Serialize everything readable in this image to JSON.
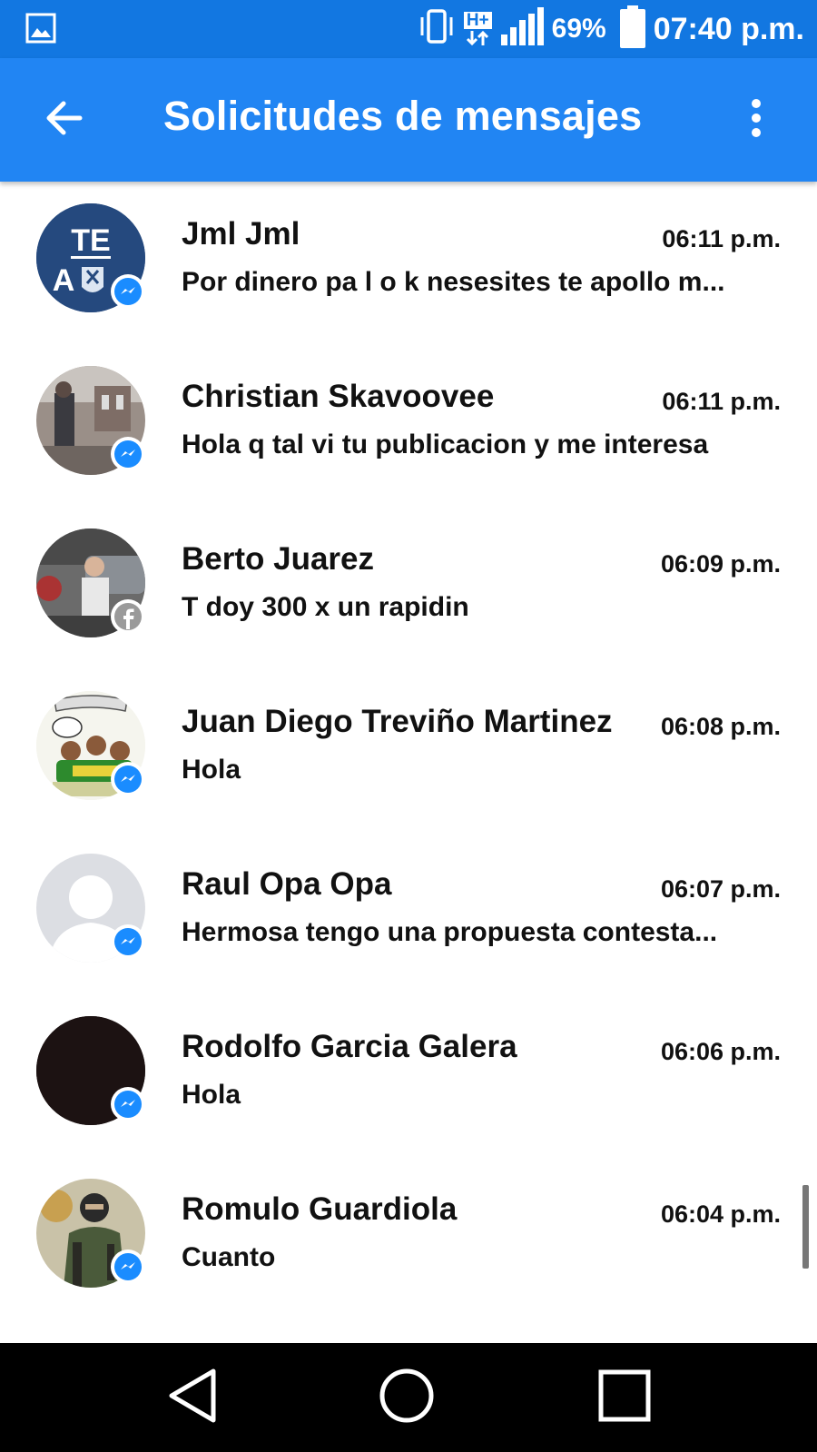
{
  "status_bar": {
    "network": "H+",
    "battery": "69%",
    "time": "07:40 p.m."
  },
  "app_bar": {
    "title": "Solicitudes de mensajes"
  },
  "colors": {
    "status_bar": "#1277e1",
    "app_bar": "#2185f3",
    "messenger_badge": "#1a8cff"
  },
  "conversations": [
    {
      "name": "Jml Jml",
      "time": "06:11 p.m.",
      "preview": "Por dinero pa l o k nesesites te apollo m...",
      "badge": "messenger-icon",
      "avatar_text": "TE A"
    },
    {
      "name": "Christian Skavoovee",
      "time": "06:11 p.m.",
      "preview": "Hola q tal vi tu publicacion y me interesa",
      "badge": "messenger-icon"
    },
    {
      "name": "Berto Juarez",
      "time": "06:09 p.m.",
      "preview": "T doy 300 x un rapidin",
      "badge": "facebook-icon"
    },
    {
      "name": "Juan Diego Treviño Martinez",
      "time": "06:08 p.m.",
      "preview": "Hola",
      "badge": "messenger-icon"
    },
    {
      "name": "Raul Opa Opa",
      "time": "06:07 p.m.",
      "preview": "Hermosa tengo una propuesta contesta...",
      "badge": "messenger-icon"
    },
    {
      "name": "Rodolfo Garcia Galera",
      "time": "06:06 p.m.",
      "preview": "Hola",
      "badge": "messenger-icon"
    },
    {
      "name": "Romulo Guardiola",
      "time": "06:04 p.m.",
      "preview": "Cuanto",
      "badge": "messenger-icon"
    }
  ]
}
